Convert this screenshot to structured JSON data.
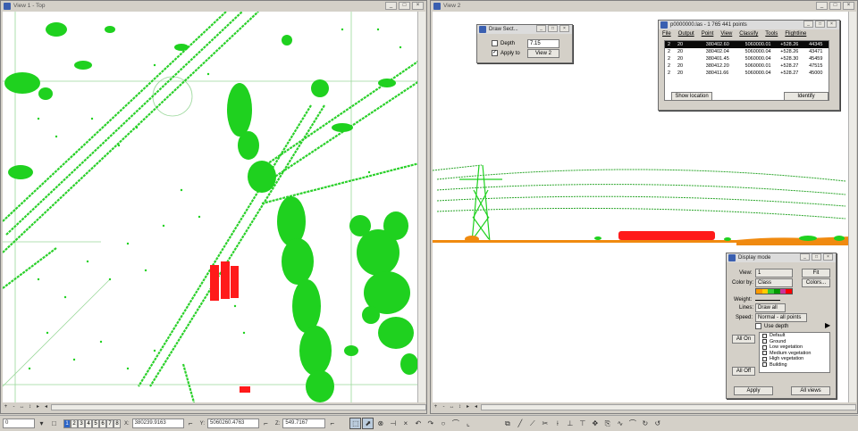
{
  "view1": {
    "title": "View 1 - Top",
    "buttons": [
      "_",
      "□",
      "×"
    ]
  },
  "view2": {
    "title": "View 2",
    "buttons": [
      "_",
      "□",
      "×"
    ]
  },
  "view_footer": {
    "icons": [
      "+",
      "-",
      "↔",
      "↕",
      "▸",
      "◂"
    ]
  },
  "draw_section": {
    "title": "Draw Sect...",
    "depth_label": "Depth",
    "depth_value": "7.15",
    "depth_checked": "",
    "apply_label": "Apply to",
    "apply_checked": "✓",
    "apply_value": "View 2"
  },
  "points_dialog": {
    "title": "p0000000.las - 1 765 441 points",
    "menu": [
      "File",
      "Output",
      "Point",
      "View",
      "Classify",
      "Tools",
      "Flightline"
    ],
    "rows": [
      [
        "2",
        "20",
        "380402.60",
        "5060000.01",
        "+528.26",
        "44345"
      ],
      [
        "2",
        "20",
        "380402.04",
        "5060000.04",
        "+528.26",
        "43471"
      ],
      [
        "2",
        "20",
        "380401.45",
        "5060000.04",
        "+528.30",
        "45459"
      ],
      [
        "2",
        "20",
        "380412.20",
        "5060000.01",
        "+528.27",
        "47515"
      ],
      [
        "2",
        "20",
        "380411.66",
        "5060000.04",
        "+528.27",
        "45000"
      ]
    ],
    "show_location": "Show location",
    "identify": "Identify"
  },
  "display_mode": {
    "title": "Display mode",
    "view_label": "View:",
    "view_value": "1",
    "fit": "Fit",
    "color_label": "Color by:",
    "color_value": "Class",
    "colors_btn": "Colors...",
    "weight_label": "Weight:",
    "lines_label": "Lines:",
    "lines_value": "Draw all",
    "speed_label": "Speed:",
    "speed_value": "Normal - all points",
    "use_depth": "Use depth",
    "all_on": "All On",
    "all_off": "All Off",
    "classes": [
      "Default",
      "Ground",
      "Low vegetation",
      "Medium vegetation",
      "High vegetation",
      "Building"
    ],
    "apply": "Apply",
    "all_views": "All views",
    "swatches": [
      "#ff9900",
      "#ffcc00",
      "#33cc33",
      "#009900",
      "#cc3399",
      "#ff0000"
    ]
  },
  "statusbar": {
    "level": "0",
    "view_numbers": [
      "1",
      "2",
      "3",
      "4",
      "5",
      "6",
      "7",
      "8"
    ],
    "x_label": "X:",
    "x_value": "380239.9163",
    "y_label": "Y:",
    "y_value": "5060260.4763",
    "z_label": "Z:",
    "z_value": "549.7167"
  },
  "colors": {
    "vegetation": "#1fd11f",
    "building": "#ff1a1a",
    "ground": "#f08a10",
    "wire": "#2aa52a",
    "guide_line": "#9ad89a"
  }
}
